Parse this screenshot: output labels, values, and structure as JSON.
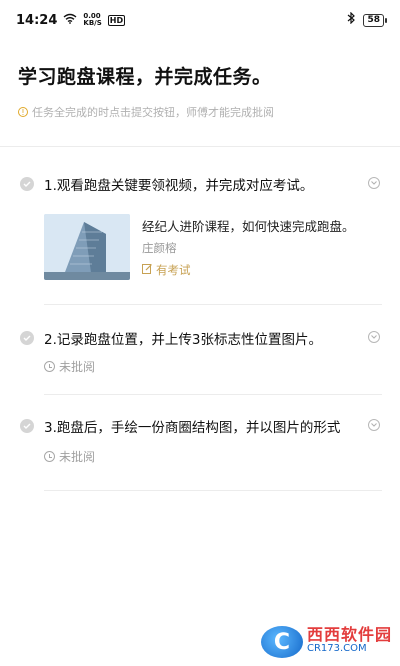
{
  "status_bar": {
    "time": "14:24",
    "net_speed_value": "0.00",
    "net_speed_unit": "KB/S",
    "hd_badge": "HD",
    "battery": "58"
  },
  "page_title": "学习跑盘课程，并完成任务。",
  "notice": "任务全完成的时点击提交按钮，师傅才能完成批阅",
  "tasks": [
    {
      "title": "1.观看跑盘关键要领视频，并完成对应考试。",
      "course": {
        "name": "经纪人进阶课程，如何快速完成跑盘。",
        "teacher": "庄颜榕",
        "tag": "有考试"
      }
    },
    {
      "title": "2.记录跑盘位置，并上传3张标志性位置图片。",
      "status": "未批阅"
    },
    {
      "title": "3.跑盘后，手绘一份商圈结构图，并以图片的形式",
      "status": "未批阅"
    }
  ],
  "watermark": {
    "logo_letter": "C",
    "title": "西西软件园",
    "url": "CR173.COM"
  },
  "colors": {
    "accent_gold": "#c7a153",
    "notice_icon": "#e0a92a",
    "check_gray": "#d5d5d5"
  }
}
